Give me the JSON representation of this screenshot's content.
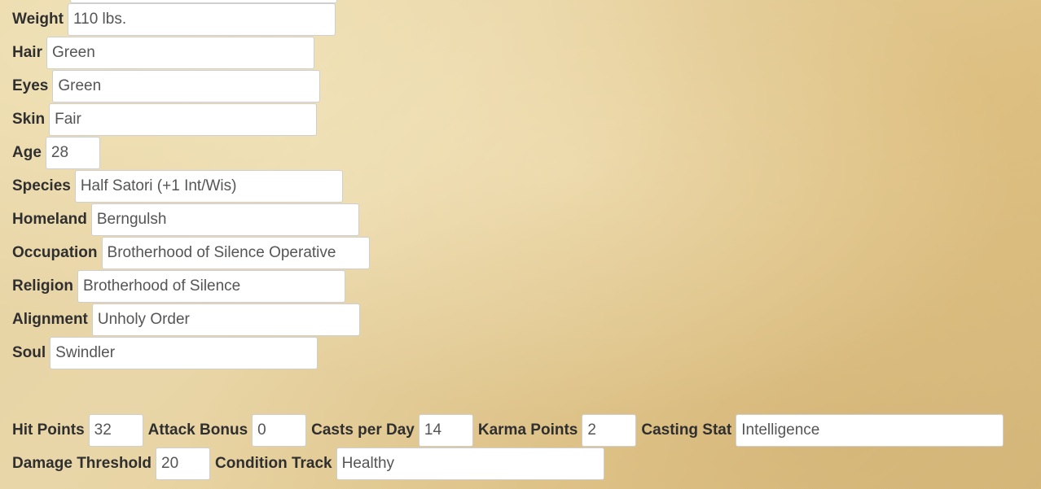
{
  "character": {
    "weight": {
      "label": "Weight",
      "value": "110 lbs."
    },
    "hair": {
      "label": "Hair",
      "value": "Green"
    },
    "eyes": {
      "label": "Eyes",
      "value": "Green"
    },
    "skin": {
      "label": "Skin",
      "value": "Fair"
    },
    "age": {
      "label": "Age",
      "value": "28"
    },
    "species": {
      "label": "Species",
      "value": "Half Satori (+1 Int/Wis)"
    },
    "homeland": {
      "label": "Homeland",
      "value": "Berngulsh"
    },
    "occupation": {
      "label": "Occupation",
      "value": "Brotherhood of Silence Operative"
    },
    "religion": {
      "label": "Religion",
      "value": "Brotherhood of Silence"
    },
    "alignment": {
      "label": "Alignment",
      "value": "Unholy Order"
    },
    "soul": {
      "label": "Soul",
      "value": "Swindler"
    }
  },
  "stats": {
    "hit_points": {
      "label": "Hit Points",
      "value": "32"
    },
    "attack_bonus": {
      "label": "Attack Bonus",
      "value": "0"
    },
    "casts_per_day": {
      "label": "Casts per Day",
      "value": "14"
    },
    "karma_points": {
      "label": "Karma Points",
      "value": "2"
    },
    "casting_stat": {
      "label": "Casting Stat",
      "value": "Intelligence"
    },
    "damage_threshold": {
      "label": "Damage Threshold",
      "value": "20"
    },
    "condition_track": {
      "label": "Condition Track",
      "value": "Healthy"
    }
  }
}
